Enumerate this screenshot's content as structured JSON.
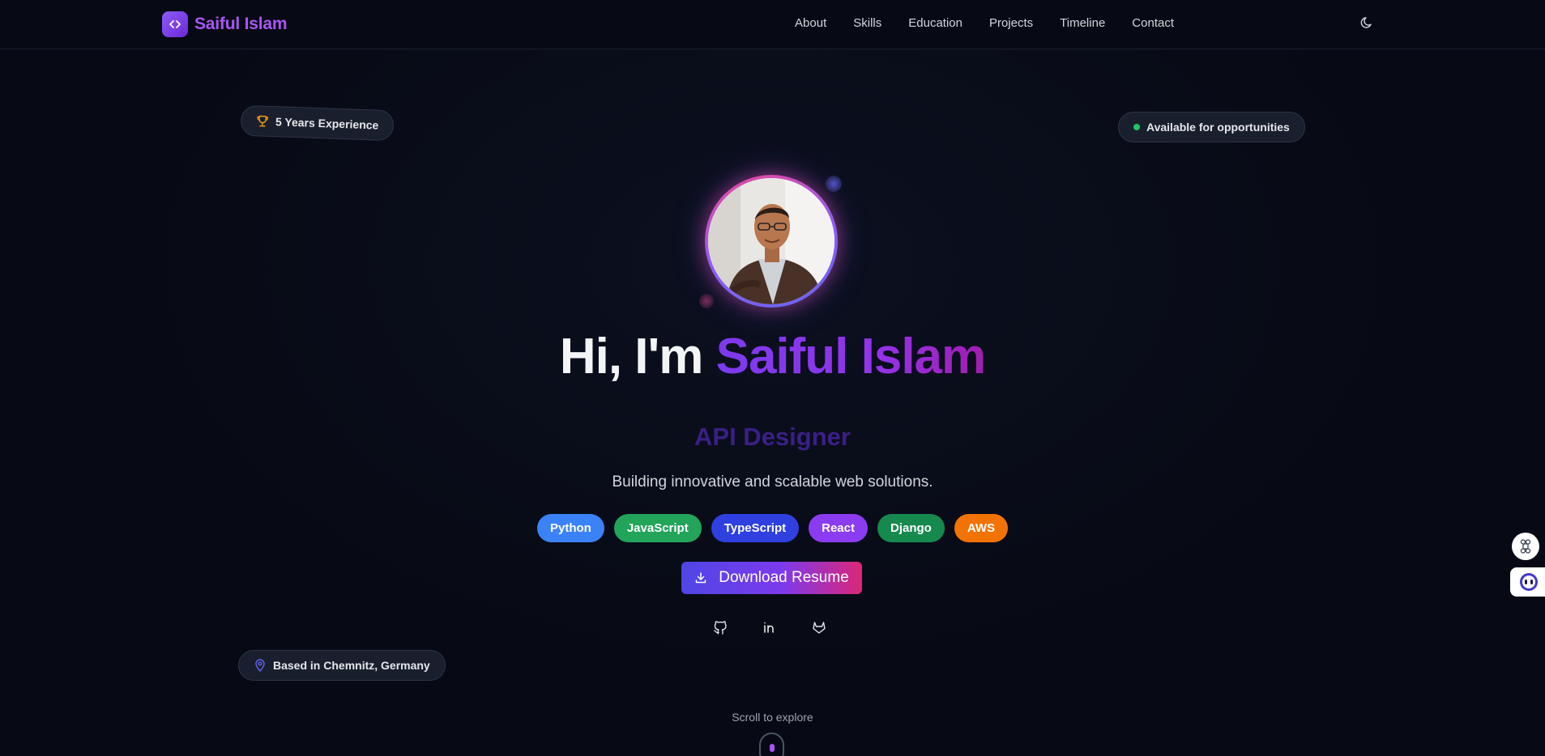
{
  "brand": {
    "name": "Saiful Islam",
    "icon": "code-icon",
    "accent": "#a855f7"
  },
  "nav": {
    "links": [
      "About",
      "Skills",
      "Education",
      "Projects",
      "Timeline",
      "Contact"
    ],
    "theme_icon": "moon-icon"
  },
  "badges": {
    "experience": "5 Years Experience",
    "availability": "Available for opportunities",
    "location": "Based in Chemnitz, Germany"
  },
  "hero": {
    "greeting": "Hi, I'm ",
    "name": "Saiful Islam",
    "role": "API Designer",
    "tagline": "Building innovative and scalable web solutions."
  },
  "tech": [
    {
      "label": "Python",
      "color": "#3b82f6"
    },
    {
      "label": "JavaScript",
      "color": "#22a55a"
    },
    {
      "label": "TypeScript",
      "color": "#2f3fe0"
    },
    {
      "label": "React",
      "color": "#8b3cf0"
    },
    {
      "label": "Django",
      "color": "#16894f"
    },
    {
      "label": "AWS",
      "color": "#f27303"
    }
  ],
  "cta": {
    "label": "Download Resume",
    "icon": "download-icon"
  },
  "social": [
    "github-icon",
    "linkedin-icon",
    "gitlab-icon"
  ],
  "scroll": {
    "label": "Scroll to explore"
  }
}
